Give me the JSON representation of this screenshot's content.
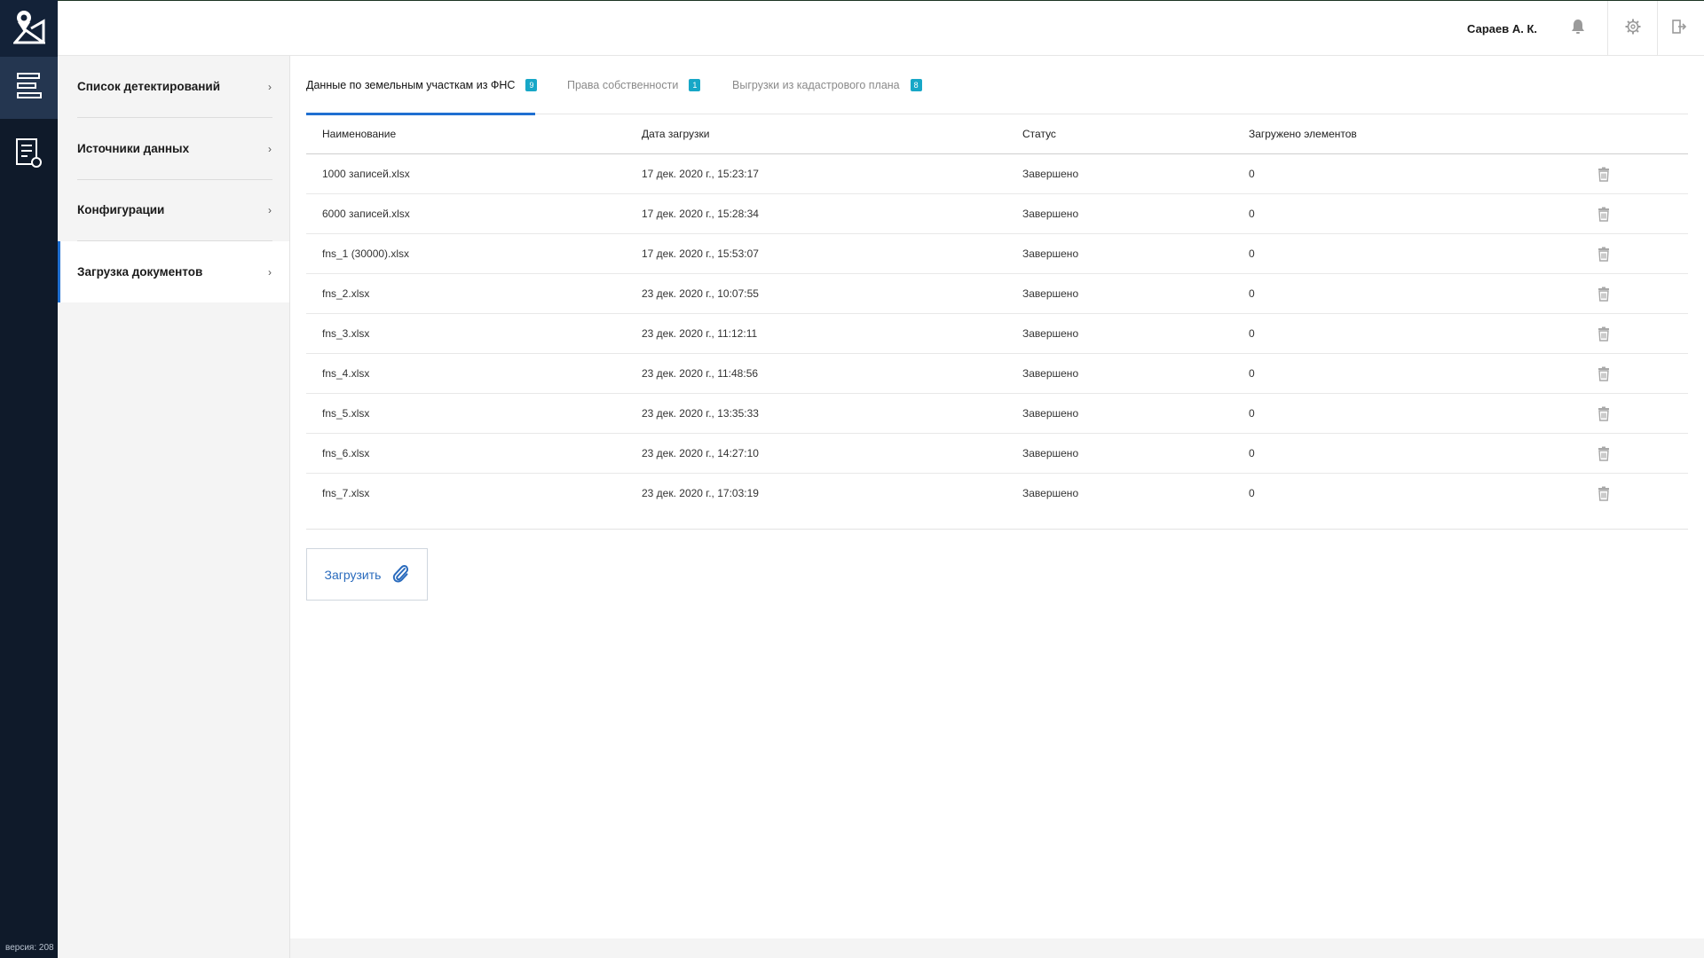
{
  "rail": {
    "version": "версия: 208",
    "icons": [
      "map-pin-logo-icon",
      "list-icon",
      "document-search-icon"
    ]
  },
  "header": {
    "user_name": "Сараев А. К.",
    "icons": [
      "bell-icon",
      "gear-icon",
      "logout-icon"
    ]
  },
  "subnav": {
    "items": [
      {
        "label": "Список детектирований",
        "active": false
      },
      {
        "label": "Источники данных",
        "active": false
      },
      {
        "label": "Конфигурации",
        "active": false
      },
      {
        "label": "Загрузка документов",
        "active": true
      }
    ]
  },
  "tabs": [
    {
      "label": "Данные по земельным участкам из ФНС",
      "count": "9",
      "active": true
    },
    {
      "label": "Права собственности",
      "count": "1",
      "active": false
    },
    {
      "label": "Выгрузки из кадастрового плана",
      "count": "8",
      "active": false
    }
  ],
  "table": {
    "headers": {
      "name": "Наименование",
      "date": "Дата загрузки",
      "status": "Статус",
      "loaded": "Загружено элементов"
    },
    "rows": [
      {
        "name": "1000 записей.xlsx",
        "date": "17 дек. 2020 г., 15:23:17",
        "status": "Завершено",
        "loaded": "0"
      },
      {
        "name": "6000 записей.xlsx",
        "date": "17 дек. 2020 г., 15:28:34",
        "status": "Завершено",
        "loaded": "0"
      },
      {
        "name": "fns_1 (30000).xlsx",
        "date": "17 дек. 2020 г., 15:53:07",
        "status": "Завершено",
        "loaded": "0"
      },
      {
        "name": "fns_2.xlsx",
        "date": "23 дек. 2020 г., 10:07:55",
        "status": "Завершено",
        "loaded": "0"
      },
      {
        "name": "fns_3.xlsx",
        "date": "23 дек. 2020 г., 11:12:11",
        "status": "Завершено",
        "loaded": "0"
      },
      {
        "name": "fns_4.xlsx",
        "date": "23 дек. 2020 г., 11:48:56",
        "status": "Завершено",
        "loaded": "0"
      },
      {
        "name": "fns_5.xlsx",
        "date": "23 дек. 2020 г., 13:35:33",
        "status": "Завершено",
        "loaded": "0"
      },
      {
        "name": "fns_6.xlsx",
        "date": "23 дек. 2020 г., 14:27:10",
        "status": "Завершено",
        "loaded": "0"
      },
      {
        "name": "fns_7.xlsx",
        "date": "23 дек. 2020 г., 17:03:19",
        "status": "Завершено",
        "loaded": "0"
      }
    ]
  },
  "upload": {
    "label": "Загрузить",
    "icon": "paperclip-icon"
  },
  "colors": {
    "accent": "#1f6fd1",
    "badge": "#17a7c7",
    "rail": "#0f1a2a"
  }
}
